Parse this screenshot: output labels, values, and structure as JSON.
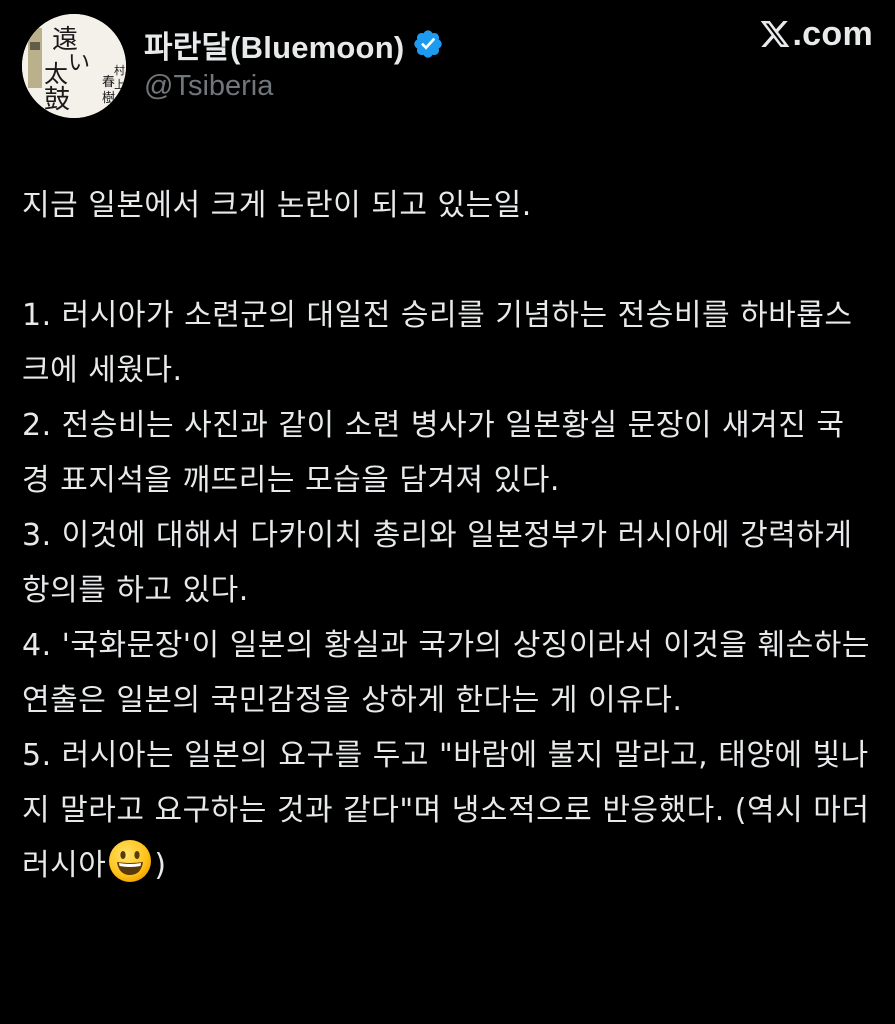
{
  "author": {
    "display_name": "파란달(Bluemoon)",
    "handle": "@Tsiberia",
    "verified": true,
    "avatar": {
      "icon": "book-cover-avatar",
      "big_text": "遠い太鼓",
      "small_text": "村上春樹"
    }
  },
  "brand": {
    "logo_icon": "x-logo-icon",
    "domain": ".com"
  },
  "tweet": {
    "intro": "지금 일본에서 크게 논란이 되고 있는일.",
    "items": [
      "1. 러시아가 소련군의 대일전 승리를 기념하는 전승비를 하바롭스크에 세웠다.",
      "2. 전승비는 사진과 같이 소련 병사가 일본황실 문장이 새겨진 국경 표지석을 깨뜨리는 모습을 담겨져 있다.",
      "3. 이것에 대해서 다카이치 총리와 일본정부가 러시아에 강력하게 항의를 하고 있다.",
      "4. '국화문장'이 일본의 황실과 국가의 상징이라서 이것을 훼손하는 연출은 일본의 국민감정을 상하게 한다는 게 이유다."
    ],
    "item5_before_emoji": "5. 러시아는 일본의 요구를 두고 \"바람에 불지 말라고, 태양에 빛나지 말라고 요구하는 것과 같다\"며 냉소적으로 반응했다. (역시 마더러시아",
    "item5_emoji": "grinning-face-emoji",
    "item5_after_emoji": ")"
  },
  "colors": {
    "background": "#000000",
    "text_primary": "#e7e9ea",
    "text_secondary": "#71767b",
    "verified_blue": "#1d9bf0"
  }
}
